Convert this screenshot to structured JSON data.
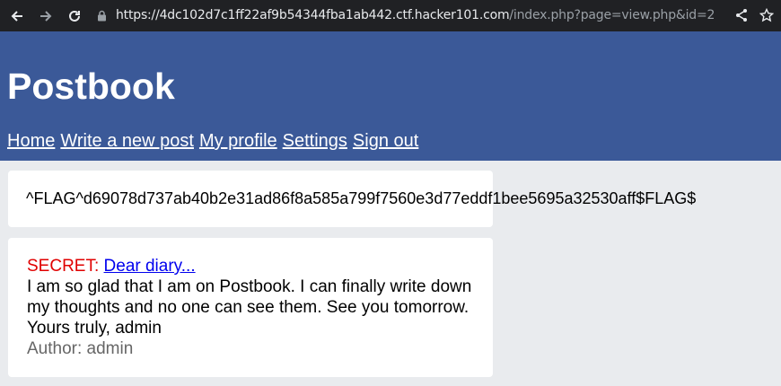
{
  "browser": {
    "url_base": "https://4dc102d7c1ff22af9b54344fba1ab442.ctf.hacker101.com",
    "url_path": "/index.php?page=view.php&id=2"
  },
  "site": {
    "title": "Postbook",
    "nav": [
      "Home",
      "Write a new post",
      "My profile",
      "Settings",
      "Sign out"
    ]
  },
  "flag": {
    "text": "^FLAG^d69078d737ab40b2e31ad86f8a585a799f7560e3d77eddf1bee5695a32530aff$FLAG$"
  },
  "post": {
    "secret_label": "SECRET:",
    "title": "Dear diary...",
    "content": "I am so glad that I am on Postbook. I can finally write down my thoughts and no one can see them. See you tomorrow. Yours truly, admin",
    "author": "Author: admin"
  }
}
